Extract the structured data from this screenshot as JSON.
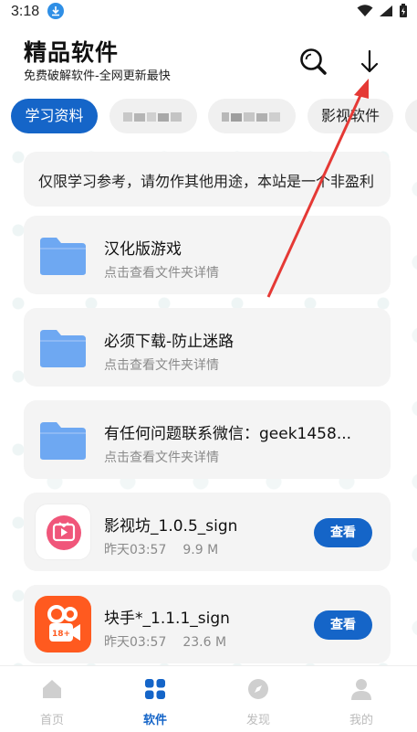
{
  "status": {
    "time": "3:18"
  },
  "header": {
    "title": "精品软件",
    "subtitle": "免费破解软件-全网更新最快"
  },
  "tabs": [
    {
      "label": "学习资料",
      "active": true
    },
    {
      "label": "",
      "blurred": true
    },
    {
      "label": "",
      "blurred": true
    },
    {
      "label": "影视软件",
      "active": false
    }
  ],
  "notice": {
    "text": "仅限学习参考，请勿作其他用途，本站是一个非盈利"
  },
  "folders": [
    {
      "title": "汉化版游戏",
      "subtitle": "点击查看文件夹详情"
    },
    {
      "title": "必须下载-防止迷路",
      "subtitle": "点击查看文件夹详情"
    },
    {
      "title": "有任何问题联系微信：geek1458...",
      "subtitle": "点击查看文件夹详情"
    }
  ],
  "apps": [
    {
      "name": "影视坊_1.0.5_sign",
      "time": "昨天03:57",
      "size": "9.9 M",
      "button": "查看"
    },
    {
      "name": "块手*_1.1.1_sign",
      "time": "昨天03:57",
      "size": "23.6 M",
      "button": "查看",
      "badge": "18+"
    }
  ],
  "nav": [
    {
      "label": "首页",
      "icon": "home-icon",
      "active": false
    },
    {
      "label": "软件",
      "icon": "apps-grid-icon",
      "active": true
    },
    {
      "label": "发现",
      "icon": "compass-icon",
      "active": false
    },
    {
      "label": "我的",
      "icon": "user-icon",
      "active": false
    }
  ],
  "colors": {
    "accent": "#1565c8",
    "annotation": "#e53935",
    "folder": "#6ea8f2"
  }
}
